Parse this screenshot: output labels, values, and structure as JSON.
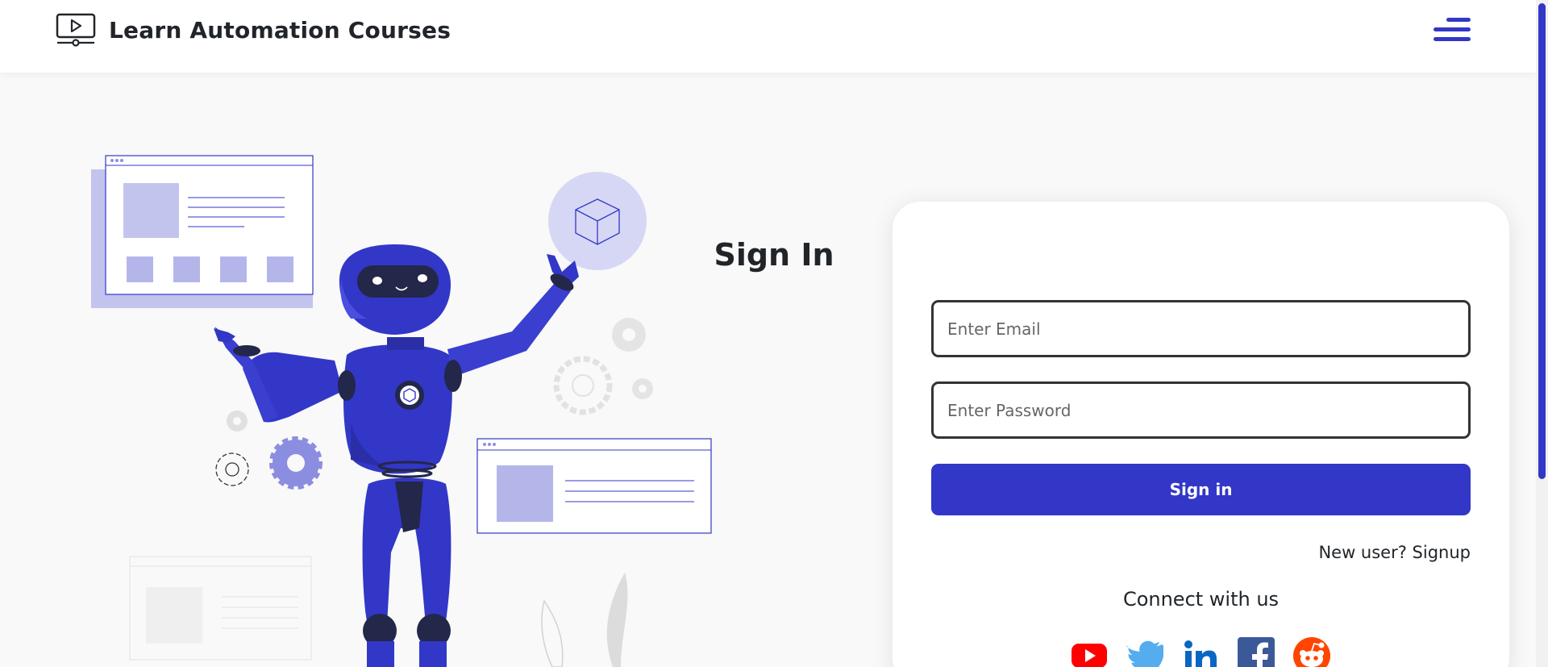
{
  "nav": {
    "brand_name": "Learn Automation Courses",
    "brand_icon": "video-course-icon",
    "menu_icon": "hamburger-menu-icon",
    "accent_color": "#3237c7"
  },
  "signin": {
    "title": "Sign In",
    "email_placeholder": "Enter Email",
    "password_placeholder": "Enter Password",
    "button_label": "Sign in",
    "signup_text": "New user? Signup",
    "connect_title": "Connect with us"
  },
  "socials": [
    {
      "name": "youtube-icon",
      "color": "#ff0000"
    },
    {
      "name": "twitter-icon",
      "color": "#55acee"
    },
    {
      "name": "linkedin-icon",
      "color": "#0a66c2"
    },
    {
      "name": "facebook-icon",
      "color": "#3b5998"
    },
    {
      "name": "reddit-icon",
      "color": "#ff4500"
    }
  ]
}
